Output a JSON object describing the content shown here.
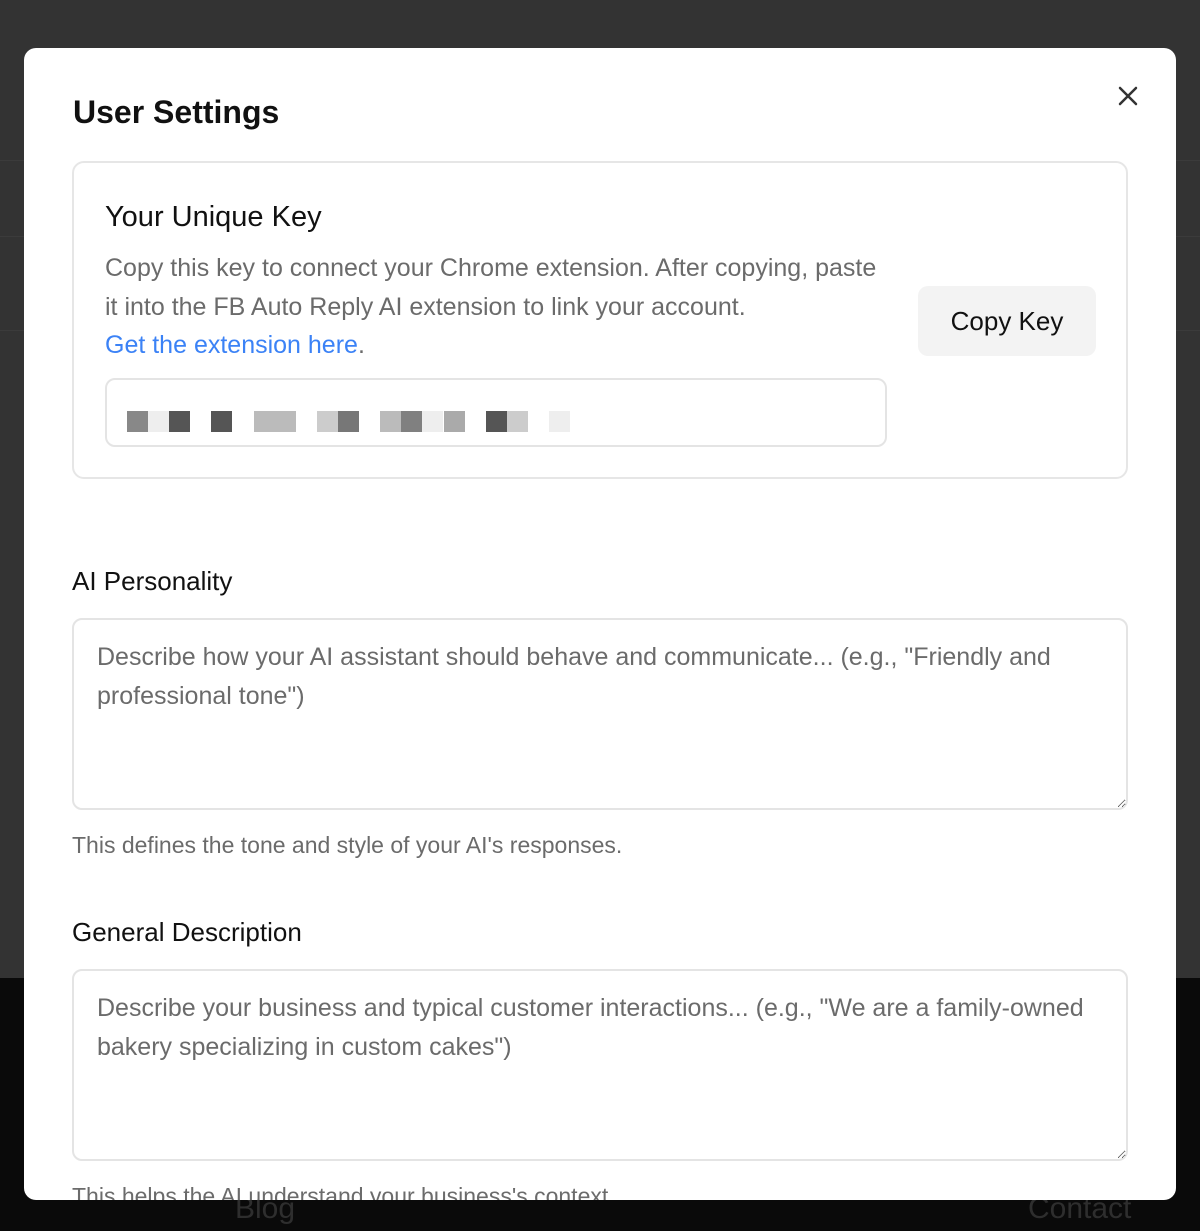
{
  "modal": {
    "title": "User Settings"
  },
  "key": {
    "heading": "Your Unique Key",
    "description": "Copy this key to connect your Chrome extension. After copying, paste it into the FB Auto Reply AI extension to link your account.",
    "link": "Get the extension here",
    "link_suffix": ".",
    "copy_label": "Copy Key",
    "masked_blocks": [
      "#888888",
      "#eeeeee",
      "#555555",
      null,
      "#555555",
      null,
      "#bbbbbb",
      "#bbbbbb",
      null,
      "#cccccc",
      "#777777",
      null,
      "#bbbbbb",
      "#808080",
      "#eeeeee",
      "#aaaaaa",
      null,
      "#555555",
      "#cccccc",
      null,
      "#eeeeee"
    ]
  },
  "personality": {
    "label": "AI Personality",
    "placeholder": "Describe how your AI assistant should behave and communicate... (e.g., \"Friendly and professional tone\")",
    "help": "This defines the tone and style of your AI's responses."
  },
  "general": {
    "label": "General Description",
    "placeholder": "Describe your business and typical customer interactions... (e.g., \"We are a family-owned bakery specializing in custom cakes\")",
    "help": "This helps the AI understand your business's context."
  },
  "footer": {
    "links": [
      "Blog",
      "Contact"
    ]
  }
}
